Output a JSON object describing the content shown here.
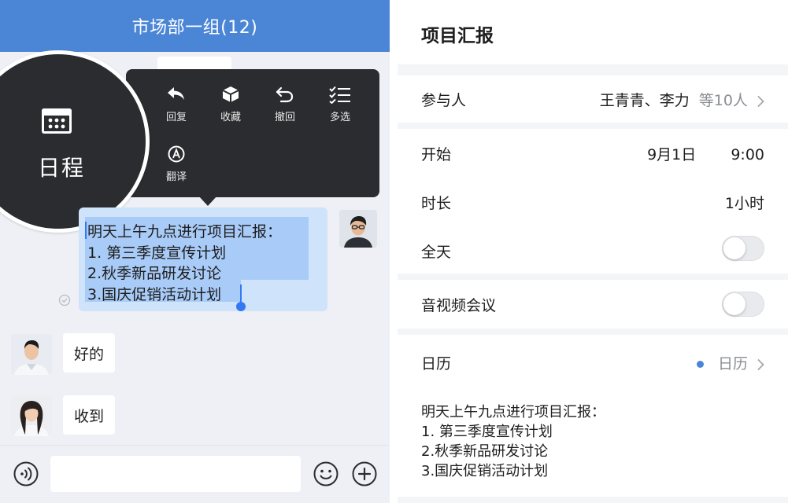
{
  "chat": {
    "title": "市场部一组(12)",
    "menu": {
      "reply": "回复",
      "favorite": "收藏",
      "recall": "撤回",
      "multi_select": "多选",
      "translate": "翻译",
      "schedule": "日程"
    },
    "message": {
      "lines": [
        "明天上午九点进行项目汇报：",
        "1. 第三季度宣传计划",
        "2.秋季新品研发讨论",
        "3.国庆促销活动计划"
      ]
    },
    "replies": [
      "好的",
      "收到"
    ]
  },
  "event": {
    "title": "项目汇报",
    "participants_label": "参与人",
    "participants_names": "王青青、李力",
    "participants_more": "等10人",
    "start_label": "开始",
    "start_date": "9月1日",
    "start_time": "9:00",
    "duration_label": "时长",
    "duration_value": "1小时",
    "all_day_label": "全天",
    "all_day_on": false,
    "video_label": "音视频会议",
    "video_on": false,
    "calendar_label": "日历",
    "calendar_value": "日历",
    "description": [
      "明天上午九点进行项目汇报：",
      "1. 第三季度宣传计划",
      "2.秋季新品研发讨论",
      "3.国庆促销活动计划"
    ]
  },
  "colors": {
    "header_blue": "#4b86d6",
    "menu_dark": "#2b2c2f",
    "selection_blue": "#a9cbf7",
    "bubble_blue": "#cfe3fb",
    "caret_blue": "#3478f6"
  }
}
